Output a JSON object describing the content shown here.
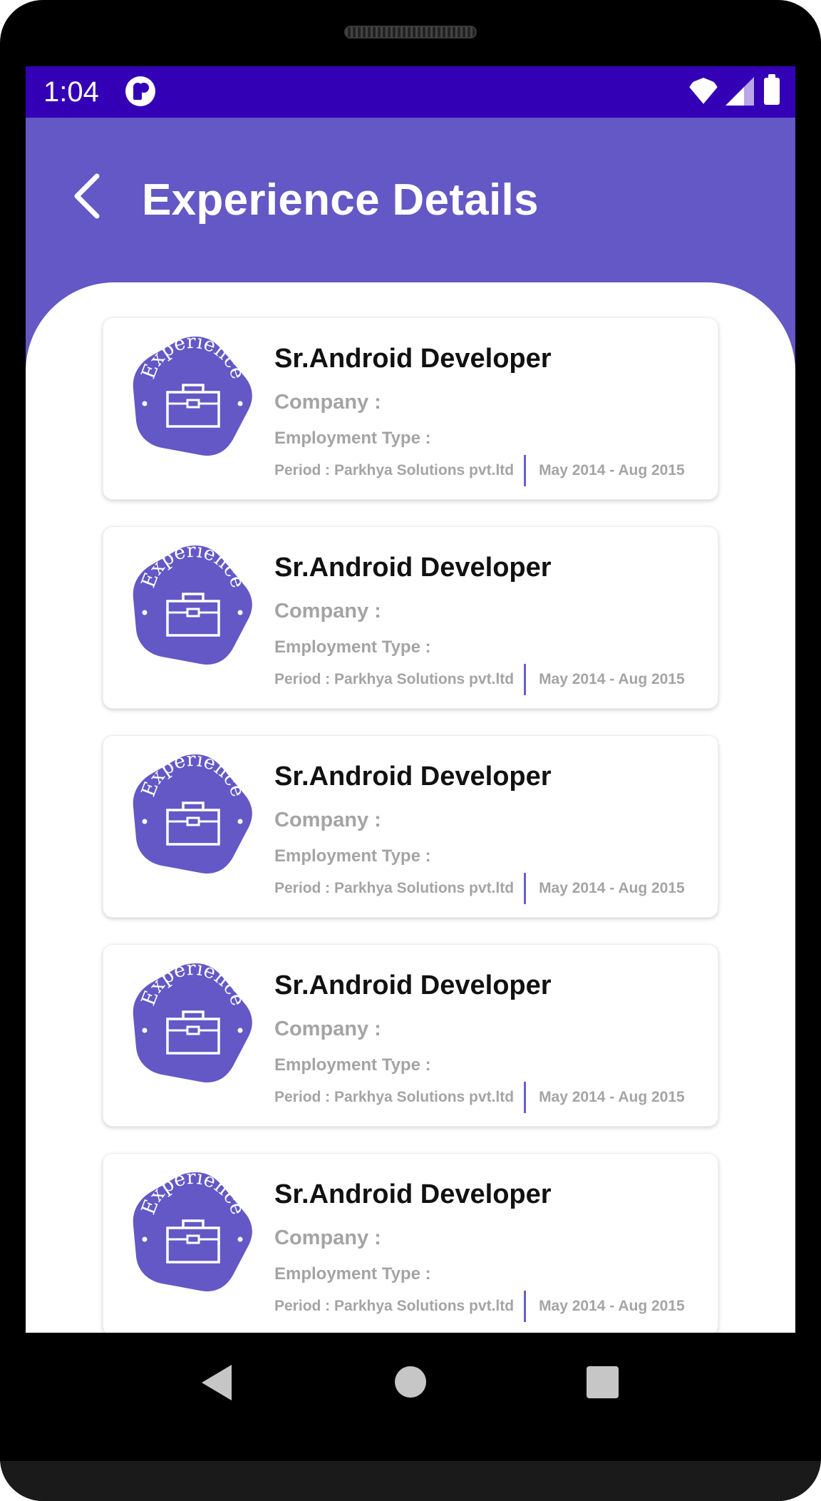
{
  "status_bar": {
    "time": "1:04"
  },
  "header": {
    "title": "Experience Details"
  },
  "colors": {
    "status_bar": "#3400b6",
    "header": "#6358c5",
    "accent": "#6a5ec6",
    "muted_text": "#a4a4a4"
  },
  "experiences": [
    {
      "badge_text": "Experience",
      "title": "Sr.Android Developer",
      "company_label": "Company :",
      "employment_type_label": "Employment Type :",
      "period": "Period : Parkhya Solutions pvt.ltd",
      "dates": "May 2014 - Aug 2015"
    },
    {
      "badge_text": "Experience",
      "title": "Sr.Android Developer",
      "company_label": "Company :",
      "employment_type_label": "Employment Type :",
      "period": "Period : Parkhya Solutions pvt.ltd",
      "dates": "May 2014 - Aug 2015"
    },
    {
      "badge_text": "Experience",
      "title": "Sr.Android Developer",
      "company_label": "Company :",
      "employment_type_label": "Employment Type :",
      "period": "Period : Parkhya Solutions pvt.ltd",
      "dates": "May 2014 - Aug 2015"
    },
    {
      "badge_text": "Experience",
      "title": "Sr.Android Developer",
      "company_label": "Company :",
      "employment_type_label": "Employment Type :",
      "period": "Period : Parkhya Solutions pvt.ltd",
      "dates": "May 2014 - Aug 2015"
    },
    {
      "badge_text": "Experience",
      "title": "Sr.Android Developer",
      "company_label": "Company :",
      "employment_type_label": "Employment Type :",
      "period": "Period : Parkhya Solutions pvt.ltd",
      "dates": "May 2014 - Aug 2015"
    }
  ],
  "icons": {
    "back": "chevron-left-icon",
    "badge": "briefcase-icon",
    "wifi": "wifi-icon",
    "signal": "signal-icon",
    "battery": "battery-icon"
  }
}
